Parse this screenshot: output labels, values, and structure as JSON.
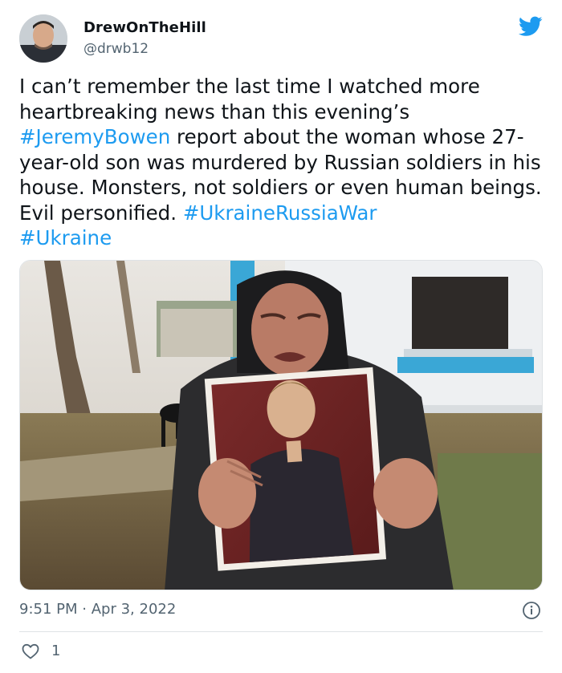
{
  "tweet": {
    "author_name": "DrewOnTheHill",
    "author_handle": "@drwb12",
    "text_parts": [
      "I can’t remember the last time I watched more heartbreaking news than this evening’s ",
      "#JeremyBowen",
      " report about the woman whose 27-year-old son was murdered by Russian soldiers in his house. Monsters, not soldiers or even human beings. Evil personified. ",
      "#UkraineRussiaWar",
      " ",
      "#Ukraine"
    ],
    "time": "9:51 PM",
    "separator": "·",
    "date": "Apr 3, 2022",
    "like_count": "1"
  },
  "icons": {
    "brand": "twitter-bird-icon",
    "info": "info-icon",
    "like": "heart-icon"
  },
  "colors": {
    "link": "#1d9bf0",
    "brand": "#1d9bf0",
    "text": "#0f1419",
    "secondary": "#536471"
  }
}
